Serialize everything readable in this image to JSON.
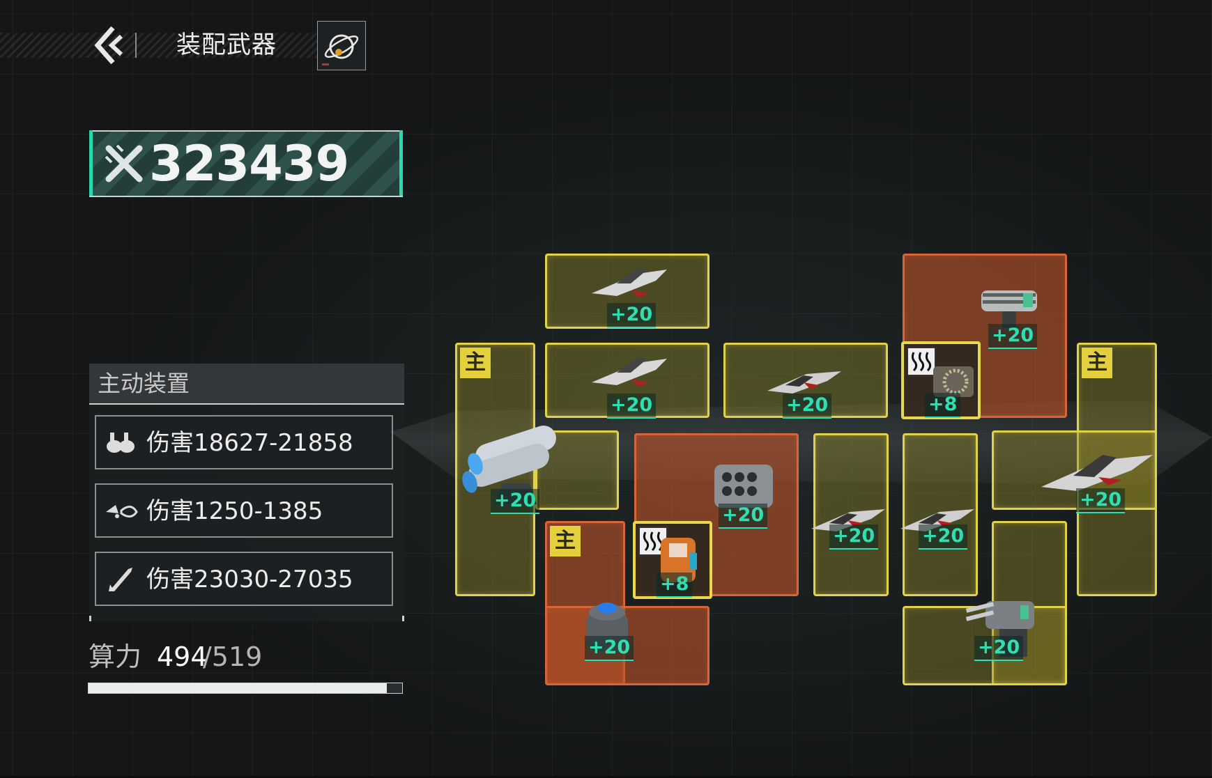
{
  "header": {
    "title": "装配武器",
    "back_icon": "back-chevron-icon",
    "ship_icon": "planet-ship-icon"
  },
  "power": {
    "icon": "crossed-swords-icon",
    "value": "323439",
    "accent": "#27d8b0"
  },
  "active_equipment": {
    "title": "主动装置",
    "stats": [
      {
        "icon": "twin-turret-icon",
        "text": "伤害18627-21858"
      },
      {
        "icon": "drone-icon",
        "text": "伤害1250-1385"
      },
      {
        "icon": "missile-icon",
        "text": "伤害23030-27035"
      }
    ]
  },
  "compute": {
    "label": "算力",
    "used": "494",
    "total": "/519",
    "fraction": 0.952
  },
  "slots": {
    "badge_main": "主",
    "levels": {
      "s_top_fighter": "+20",
      "s_mid_fighter": "+20",
      "s_mid2_fighter": "+20",
      "s_gatling": "+20",
      "s_heat_top": "+8",
      "s_left_cannon": "+20",
      "s_missile_pod": "+20",
      "s_heat_bottom": "+8",
      "s_col_a": "+20",
      "s_col_b": "+20",
      "s_right_fighter": "+20",
      "s_dome": "+20",
      "s_quad_turret": "+20"
    }
  },
  "colors": {
    "yellow_slot": "#e2d24a",
    "orange_slot": "#d8653a",
    "level_text": "#2de0b2"
  }
}
